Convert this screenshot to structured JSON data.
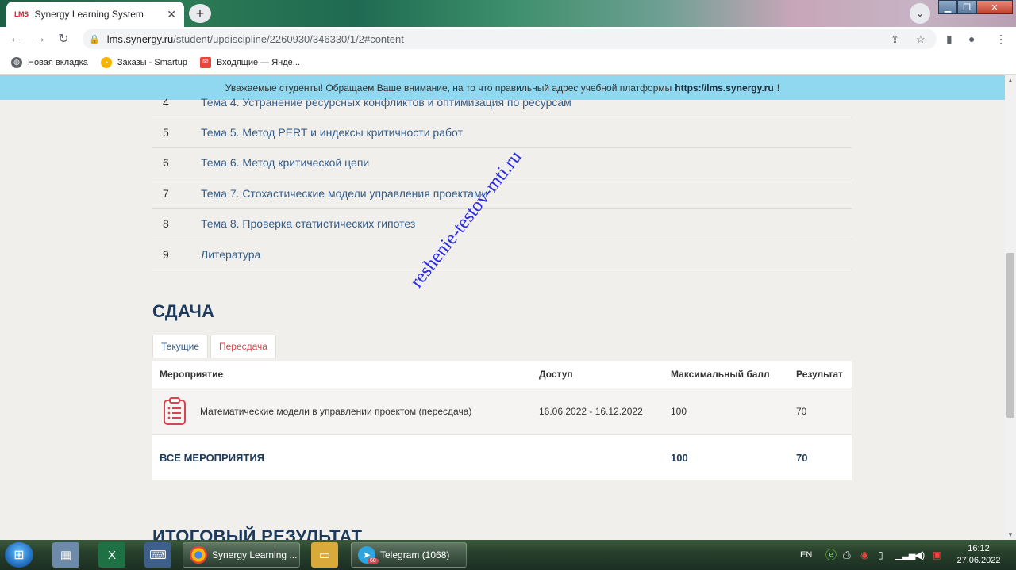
{
  "browser": {
    "tab_title": "Synergy Learning System",
    "tab_favicon": "LMS",
    "new_tab_symbol": "+",
    "url_host": "lms.synergy.ru",
    "url_path": "/student/updiscipline/2260930/346330/1/2#content",
    "bookmarks": [
      {
        "label": "Новая вкладка",
        "icon": "globe-icon",
        "color": "#5f6368"
      },
      {
        "label": "Заказы - Smartup",
        "icon": "smartup-icon",
        "color": "#f4b400"
      },
      {
        "label": "Входящие — Янде...",
        "icon": "mail-icon",
        "color": "#e8453c"
      }
    ]
  },
  "notice": {
    "text": "Уважаемые студенты! Обращаем Ваше внимание, на то что правильный адрес учебной платформы",
    "link": "https://lms.synergy.ru",
    "suffix": "!"
  },
  "topics": [
    {
      "num": "4",
      "title": "Тема 4. Устранение ресурсных конфликтов и оптимизация по ресурсам"
    },
    {
      "num": "5",
      "title": "Тема 5. Метод PERT и индексы критичности работ"
    },
    {
      "num": "6",
      "title": "Тема 6. Метод критической цепи"
    },
    {
      "num": "7",
      "title": "Тема 7. Стохастические модели управления проектами"
    },
    {
      "num": "8",
      "title": "Тема 8. Проверка статистических гипотез"
    },
    {
      "num": "9",
      "title": "Литература"
    }
  ],
  "submission": {
    "title": "СДАЧА",
    "tabs": {
      "current": "Текущие",
      "retake": "Пересдача"
    },
    "columns": {
      "event": "Мероприятие",
      "access": "Доступ",
      "max_score": "Максимальный балл",
      "result": "Результат"
    },
    "row": {
      "event": "Математические модели в управлении проектом (пересдача)",
      "access": "16.06.2022 - 16.12.2022",
      "max_score": "100",
      "result": "70"
    },
    "total": {
      "label": "ВСЕ МЕРОПРИЯТИЯ",
      "max_score": "100",
      "result": "70"
    }
  },
  "next_section_title": "ИТОГОВЫЙ РЕЗУЛЬТАТ",
  "watermark": "reshenie-testov-mti.ru",
  "taskbar": {
    "chrome_label": "Synergy Learning ...",
    "telegram_label": "Telegram (1068)",
    "telegram_badge": "68",
    "language": "EN",
    "time": "16:12",
    "date": "27.06.2022"
  }
}
